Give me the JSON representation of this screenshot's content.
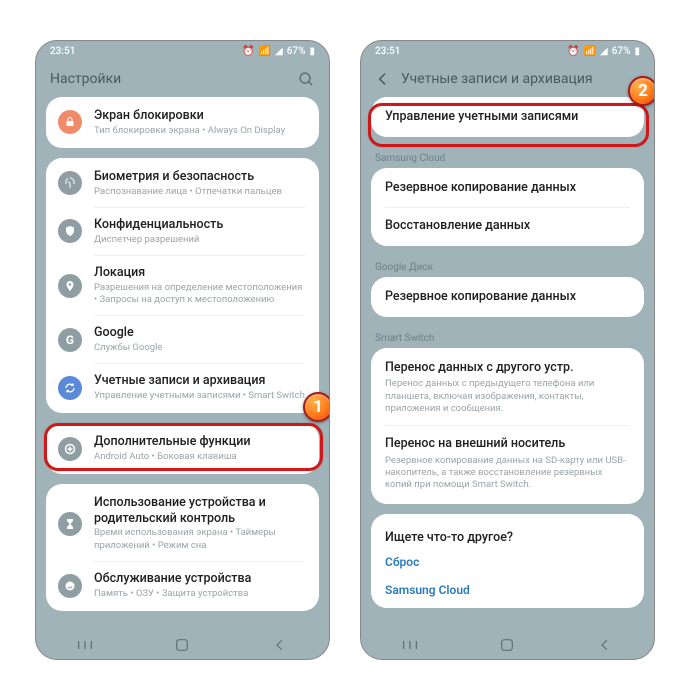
{
  "status": {
    "time": "23:51",
    "battery": "67%"
  },
  "left": {
    "title": "Настройки",
    "rows": [
      {
        "icon": "lock-icon",
        "cls": "orange",
        "t1": "Экран блокировки",
        "t2": "Тип блокировки экрана  •  Always On Display"
      },
      {
        "icon": "finger-icon",
        "cls": "",
        "t1": "Биометрия и безопасность",
        "t2": "Распознавание лица  •  Отпечатки пальцев"
      },
      {
        "icon": "shield-icon",
        "cls": "",
        "t1": "Конфиденциальность",
        "t2": "Диспетчер разрешений"
      },
      {
        "icon": "pin-icon",
        "cls": "",
        "t1": "Локация",
        "t2": "Разрешения на определение местоположения  •  Запросы на доступ к местоположению"
      },
      {
        "icon": "google-icon",
        "cls": "",
        "t1": "Google",
        "t2": "Службы Google"
      },
      {
        "icon": "sync-icon",
        "cls": "blue",
        "t1": "Учетные записи и архивация",
        "t2": "Управление учетными записями  •  Smart Switch"
      },
      {
        "icon": "plus-icon",
        "cls": "",
        "t1": "Дополнительные функции",
        "t2": "Android Auto  •  Боковая клавиша"
      },
      {
        "icon": "hourglass-icon",
        "cls": "",
        "t1": "Использование устройства и родительский контроль",
        "t2": "Время использования экрана  •  Таймеры приложений  •  Режим сна"
      },
      {
        "icon": "care-icon",
        "cls": "",
        "t1": "Обслуживание устройства",
        "t2": "Память  •  ОЗУ  •  Защита устройства"
      }
    ]
  },
  "right": {
    "title": "Учетные записи и архивация",
    "rows1": [
      {
        "t1": "Управление учетными записями"
      }
    ],
    "section2": "Samsung Cloud",
    "rows2": [
      {
        "t1": "Резервное копирование данных"
      },
      {
        "t1": "Восстановление данных"
      }
    ],
    "section3": "Google Диск",
    "rows3": [
      {
        "t1": "Резервное копирование данных"
      }
    ],
    "section4": "Smart Switch",
    "rows4": [
      {
        "t1": "Перенос данных с другого устр.",
        "t2": "Перенос данных с предыдущего телефона или планшета, включая изображения, контакты, приложения и сообщения."
      },
      {
        "t1": "Перенос на внешний носитель",
        "t2": "Резервное копирование данных на SD-карту или USB-накопитель, а также восстановление резервных копий при помощи Smart Switch."
      }
    ],
    "other_q": "Ищете что-то другое?",
    "links": [
      "Сброс",
      "Samsung Cloud"
    ]
  },
  "badges": {
    "b1": "1",
    "b2": "2"
  }
}
